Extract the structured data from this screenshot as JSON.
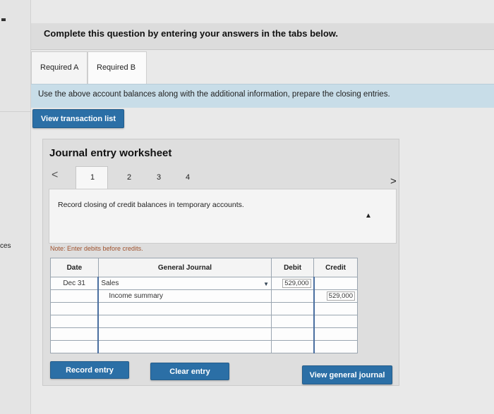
{
  "sidebar": {
    "truncated_text": "ces"
  },
  "question": {
    "instruction": "Complete this question by entering your answers in the tabs below."
  },
  "tabs": [
    {
      "label": "Required A"
    },
    {
      "label": "Required B"
    }
  ],
  "info": {
    "text": "Use the above account balances along with the additional information, prepare the closing entries."
  },
  "buttons": {
    "view_transaction_list": "View transaction list",
    "record_entry": "Record entry",
    "clear_entry": "Clear entry",
    "view_general_journal": "View general journal"
  },
  "worksheet": {
    "title": "Journal entry worksheet",
    "nav": {
      "prev": "<",
      "next": ">",
      "pages": [
        "1",
        "2",
        "3",
        "4"
      ],
      "active": "1"
    },
    "description": "Record closing of credit balances in temporary accounts.",
    "note": "Note: Enter debits before credits.",
    "table": {
      "headers": {
        "date": "Date",
        "general_journal": "General Journal",
        "debit": "Debit",
        "credit": "Credit"
      },
      "rows": [
        {
          "date": "Dec 31",
          "account": "Sales",
          "debit": "529,000",
          "credit": ""
        },
        {
          "date": "",
          "account": "Income summary",
          "debit": "",
          "credit": "529,000"
        },
        {
          "date": "",
          "account": "",
          "debit": "",
          "credit": ""
        },
        {
          "date": "",
          "account": "",
          "debit": "",
          "credit": ""
        },
        {
          "date": "",
          "account": "",
          "debit": "",
          "credit": ""
        },
        {
          "date": "",
          "account": "",
          "debit": "",
          "credit": ""
        }
      ]
    }
  },
  "colors": {
    "button_blue": "#2b6fa6",
    "info_bar": "#c8dde8",
    "note_text": "#a0522d"
  }
}
